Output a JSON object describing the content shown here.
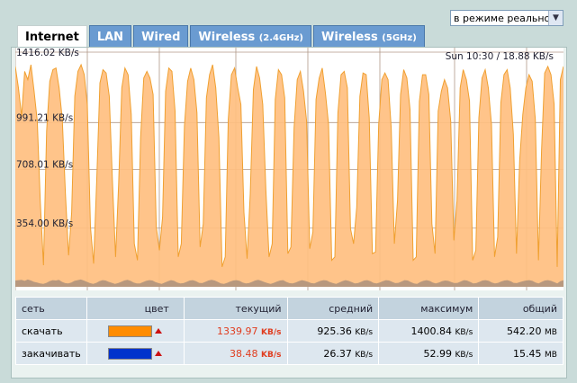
{
  "mode_select": {
    "value": "в режиме реально"
  },
  "tabs": [
    {
      "label": "Internet",
      "suffix": ""
    },
    {
      "label": "LAN",
      "suffix": ""
    },
    {
      "label": "Wired",
      "suffix": ""
    },
    {
      "label": "Wireless ",
      "suffix": "(2.4GHz)"
    },
    {
      "label": "Wireless ",
      "suffix": "(5GHz)"
    }
  ],
  "chart": {
    "stamp": "Sun 10:30 / 18.88 KB/s",
    "y_ticks": [
      "1416.02 KB/s",
      "991.21 KB/s",
      "708.01 KB/s",
      "354.00 KB/s"
    ],
    "colors": {
      "download": "#ffbf80",
      "download_line": "#f0a030",
      "upload": "#a08a7a",
      "grid": "#b09888",
      "bg": "#ffffff"
    }
  },
  "chart_data": {
    "type": "area",
    "ylim": [
      0,
      1416.02
    ],
    "y_ticks": [
      1416.02,
      991.21,
      708.01,
      354.0
    ],
    "series": [
      {
        "name": "скачать",
        "values": [
          1330,
          1200,
          1030,
          1300,
          1250,
          1340,
          1180,
          1000,
          510,
          130,
          940,
          1240,
          1310,
          1320,
          1200,
          1010,
          560,
          190,
          450,
          1150,
          1300,
          1340,
          1280,
          1100,
          360,
          140,
          650,
          1230,
          1310,
          1290,
          1150,
          640,
          180,
          620,
          1200,
          1320,
          1280,
          1040,
          260,
          160,
          900,
          1260,
          1300,
          1260,
          1160,
          360,
          220,
          420,
          1180,
          1320,
          1300,
          1060,
          180,
          260,
          970,
          1240,
          1320,
          1250,
          1050,
          240,
          380,
          1140,
          1280,
          1340,
          1200,
          900,
          120,
          180,
          1010,
          1280,
          1320,
          1200,
          1100,
          450,
          170,
          560,
          1190,
          1330,
          1260,
          1100,
          580,
          180,
          260,
          1130,
          1310,
          1280,
          1140,
          200,
          240,
          960,
          1250,
          1300,
          1180,
          1000,
          230,
          330,
          1130,
          1260,
          1320,
          1170,
          980,
          160,
          180,
          1050,
          1280,
          1300,
          1200,
          350,
          260,
          480,
          1150,
          1290,
          1280,
          1020,
          200,
          210,
          980,
          1250,
          1290,
          1250,
          960,
          260,
          520,
          1160,
          1310,
          1260,
          1070,
          160,
          180,
          1120,
          1280,
          1280,
          1160,
          380,
          200,
          1060,
          1180,
          1250,
          1200,
          1000,
          280,
          520,
          1200,
          1310,
          1250,
          1120,
          160,
          220,
          1020,
          1260,
          1310,
          1200,
          980,
          180,
          300,
          1110,
          1280,
          1310,
          1200,
          920,
          200,
          760,
          1040,
          1200,
          1280,
          1240,
          1010,
          160,
          820,
          1290,
          1330,
          1280,
          1100,
          120,
          1250,
          1330
        ],
        "color": "#ffbf80"
      },
      {
        "name": "закачивать",
        "values": [
          38,
          40,
          42,
          36,
          44,
          38,
          30,
          26,
          20,
          18,
          24,
          34,
          40,
          38,
          42,
          30,
          22,
          20,
          26,
          36,
          40,
          44,
          38,
          30,
          22,
          18,
          24,
          34,
          40,
          38,
          30,
          24,
          18,
          22,
          30,
          38,
          42,
          36,
          26,
          20,
          20,
          28,
          36,
          40,
          38,
          28,
          22,
          18,
          26,
          34,
          40,
          36,
          26,
          20,
          22,
          30,
          38,
          40,
          34,
          24,
          22,
          30,
          38,
          42,
          38,
          30,
          20,
          18,
          24,
          32,
          38,
          40,
          36,
          26,
          20,
          22,
          30,
          38,
          42,
          36,
          28,
          22,
          18,
          24,
          32,
          38,
          40,
          30,
          22,
          20,
          26,
          34,
          40,
          36,
          30,
          22,
          20,
          28,
          36,
          40,
          38,
          28,
          22,
          18,
          26,
          34,
          40,
          36,
          28,
          20,
          22,
          30,
          38,
          40,
          34,
          24,
          20,
          26,
          34,
          40,
          38,
          30,
          22,
          24,
          32,
          40,
          38,
          28,
          20,
          18,
          28,
          36,
          40,
          36,
          26,
          20,
          26,
          34,
          38,
          36,
          28,
          22,
          24,
          32,
          40,
          38,
          30,
          20,
          22,
          30,
          38,
          40,
          36,
          26,
          20,
          24,
          32,
          38,
          40,
          34,
          24,
          22,
          28,
          34,
          38,
          40,
          36,
          26,
          20,
          30,
          38,
          40,
          36,
          28,
          20,
          34,
          40
        ],
        "color": "#8c7a6c"
      }
    ],
    "legend": "table-below"
  },
  "table": {
    "headers": {
      "network": "сеть",
      "color": "цвет",
      "current": "текущий",
      "average": "средний",
      "maximum": "максимум",
      "total": "общий"
    },
    "rows": [
      {
        "network": "скачать",
        "color": "#ff8c00",
        "current": "1339.97",
        "current_unit": "KB/s",
        "average": "925.36",
        "average_unit": "KB/s",
        "maximum": "1400.84",
        "maximum_unit": "KB/s",
        "total": "542.20",
        "total_unit": "MB"
      },
      {
        "network": "закачивать",
        "color": "#0033cc",
        "current": "38.48",
        "current_unit": "KB/s",
        "average": "26.37",
        "average_unit": "KB/s",
        "maximum": "52.99",
        "maximum_unit": "KB/s",
        "total": "15.45",
        "total_unit": "MB"
      }
    ]
  }
}
